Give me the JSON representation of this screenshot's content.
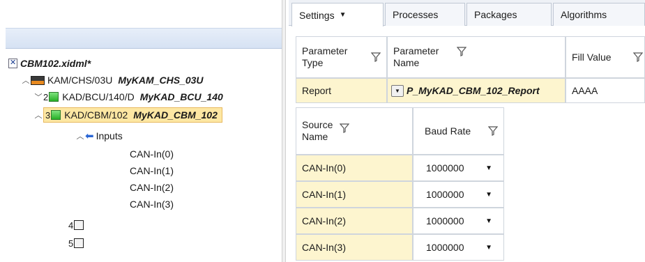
{
  "tree": {
    "file": {
      "name": "CBM102.xidml*"
    },
    "chassis": {
      "path": "KAM/CHS/03U",
      "name": "MyKAM_CHS_03U"
    },
    "modules": [
      {
        "slot": "2",
        "path": "KAD/BCU/140/D",
        "name": "MyKAD_BCU_140",
        "state": "collapsed"
      },
      {
        "slot": "3",
        "path": "KAD/CBM/102",
        "name": "MyKAD_CBM_102",
        "state": "expanded",
        "selected": true
      }
    ],
    "inputs_label": "Inputs",
    "inputs": [
      "CAN-In(0)",
      "CAN-In(1)",
      "CAN-In(2)",
      "CAN-In(3)"
    ],
    "empty_slots": [
      "4",
      "5"
    ]
  },
  "tabs": [
    {
      "label": "Settings",
      "active": true,
      "has_dropdown": true
    },
    {
      "label": "Processes"
    },
    {
      "label": "Packages"
    },
    {
      "label": "Algorithms"
    }
  ],
  "parameter_grid": {
    "headers": [
      {
        "line1": "Parameter",
        "line2": "Type"
      },
      {
        "line1": "Parameter",
        "line2": "Name"
      },
      {
        "line1": "Fill Value",
        "line2": ""
      }
    ],
    "row": {
      "type": "Report",
      "name": "P_MyKAD_CBM_102_Report",
      "fill": "AAAA"
    }
  },
  "source_grid": {
    "headers": [
      {
        "line1": "Source",
        "line2": "Name"
      },
      {
        "line1": "Baud Rate",
        "line2": ""
      }
    ],
    "rows": [
      {
        "source": "CAN-In(0)",
        "baud": "1000000"
      },
      {
        "source": "CAN-In(1)",
        "baud": "1000000"
      },
      {
        "source": "CAN-In(2)",
        "baud": "1000000"
      },
      {
        "source": "CAN-In(3)",
        "baud": "1000000"
      }
    ]
  },
  "colors": {
    "selection": "#fde7a3",
    "editable_cell": "#fdf5cf",
    "module_active": "#27b027",
    "tab_bar": "#eef1f6"
  },
  "icons": {
    "file": "xidml-file-icon",
    "chassis": "chassis-icon",
    "module": "module-green-icon",
    "empty_slot": "empty-slot-icon",
    "inputs": "arrow-left-icon",
    "filter": "filter-funnel-icon",
    "combo": "combo-dropdown-icon"
  }
}
